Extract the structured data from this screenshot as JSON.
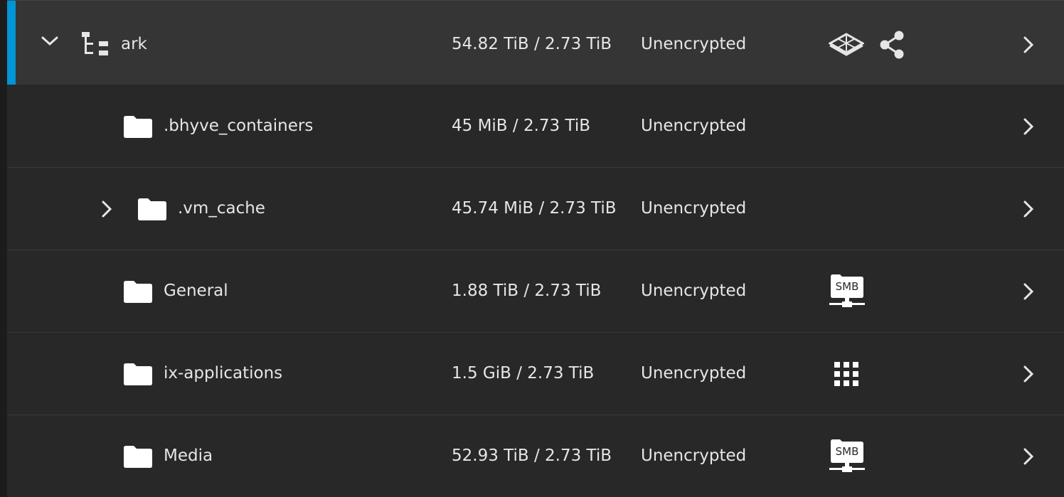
{
  "datasets": [
    {
      "name": "ark",
      "used": "54.82 TiB / 2.73 TiB",
      "encryption": "Unencrypted",
      "expanded": true,
      "type": "pool",
      "role_icons": [
        "hardware-raid-icon",
        "share-icon"
      ]
    },
    {
      "name": ".bhyve_containers",
      "used": "45 MiB / 2.73 TiB",
      "encryption": "Unencrypted",
      "type": "dataset",
      "role_icons": []
    },
    {
      "name": ".vm_cache",
      "used": "45.74 MiB / 2.73 TiB",
      "encryption": "Unencrypted",
      "type": "dataset",
      "expandable": true,
      "role_icons": []
    },
    {
      "name": "General",
      "used": "1.88 TiB / 2.73 TiB",
      "encryption": "Unencrypted",
      "type": "dataset",
      "role_icons": [
        "smb-share-icon"
      ]
    },
    {
      "name": "ix-applications",
      "used": "1.5 GiB / 2.73 TiB",
      "encryption": "Unencrypted",
      "type": "dataset",
      "role_icons": [
        "apps-grid-icon"
      ]
    },
    {
      "name": "Media",
      "used": "52.93 TiB / 2.73 TiB",
      "encryption": "Unencrypted",
      "type": "dataset",
      "role_icons": [
        "smb-share-icon"
      ]
    }
  ],
  "smb_label": "SMB",
  "colors": {
    "accent": "#0095d5",
    "row_bg": "#282828",
    "root_bg": "#353535",
    "text": "#e6e6e6"
  }
}
